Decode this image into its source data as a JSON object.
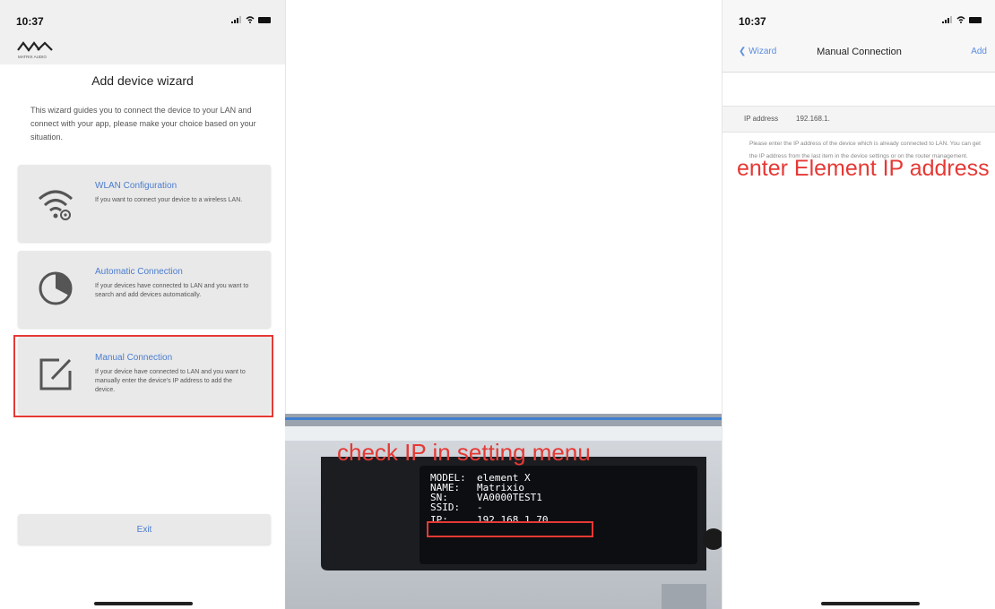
{
  "left_phone": {
    "status_time": "10:37",
    "brand_text": "MATRIX AUDIO",
    "title": "Add device wizard",
    "intro": "This wizard guides you to connect the device to your LAN and connect with your app, please make your choice based on your situation.",
    "cards": [
      {
        "title": "WLAN Configuration",
        "desc": "If you want to connect your device to a wireless LAN.",
        "icon": "wifi-gear-icon"
      },
      {
        "title": "Automatic Connection",
        "desc": "If your devices have connected to LAN and you want to search and add devices automatically.",
        "icon": "pie-icon"
      },
      {
        "title": "Manual Connection",
        "desc": "If your device have connected to LAN and you want to manually enter the device's IP address to add the device.",
        "icon": "edit-icon"
      }
    ],
    "exit_label": "Exit"
  },
  "photo": {
    "caption": "check IP in setting menu",
    "lcd": [
      {
        "key": "MODEL:",
        "value": "element X"
      },
      {
        "key": "NAME:",
        "value": "Matrixio"
      },
      {
        "key": "SN:",
        "value": "VA0000TEST1"
      },
      {
        "key": "SSID:",
        "value": "-"
      },
      {
        "key": "IP:",
        "value": "192.168.1.70"
      }
    ]
  },
  "right_phone": {
    "status_time": "10:37",
    "back_label": "Wizard",
    "title": "Manual Connection",
    "add_label": "Add",
    "ip_label": "IP address",
    "ip_value": "192.168.1.",
    "hint": "Please enter the IP address of the device which is already connected to LAN. You can get the IP address from the last item in the device settings or on the router management.",
    "caption": "enter Element IP address"
  },
  "colors": {
    "accent_blue": "#4a7ccf",
    "highlight_red": "#e53935"
  }
}
